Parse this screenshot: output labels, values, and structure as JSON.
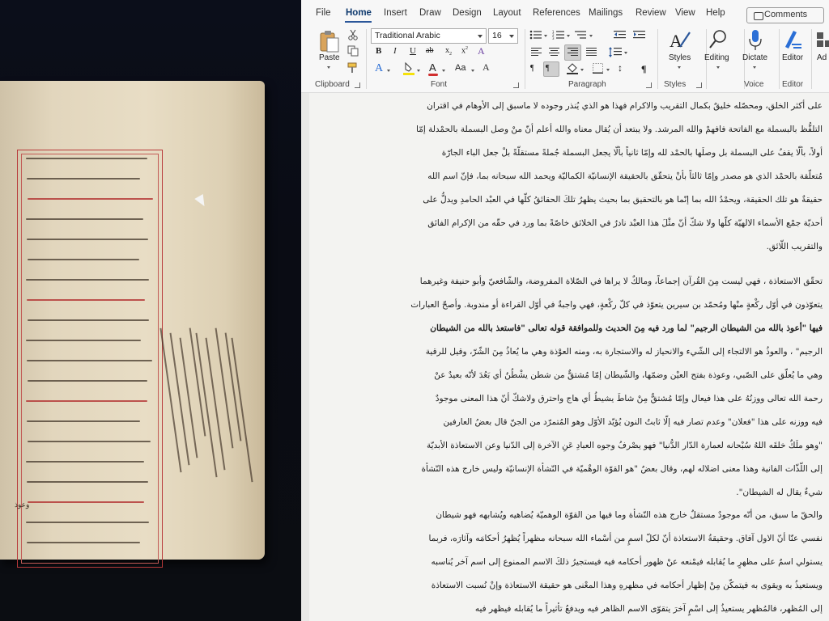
{
  "menu": {
    "file": "File",
    "home": "Home",
    "insert": "Insert",
    "draw": "Draw",
    "design": "Design",
    "layout": "Layout",
    "references": "References",
    "mailings": "Mailings",
    "review": "Review",
    "view": "View",
    "help": "Help",
    "comments": "Comments"
  },
  "ribbon": {
    "clipboard": {
      "paste": "Paste",
      "label": "Clipboard"
    },
    "font": {
      "name": "Traditional Arabic",
      "size": "16",
      "label": "Font"
    },
    "paragraph": {
      "label": "Paragraph"
    },
    "styles": {
      "button": "Styles",
      "label": "Styles"
    },
    "editing": {
      "button": "Editing"
    },
    "voice": {
      "button": "Dictate",
      "label": "Voice"
    },
    "editor": {
      "button": "Editor",
      "label": "Editor"
    },
    "addins": {
      "button": "Ad"
    }
  },
  "icons": [
    "paste-icon",
    "cut-icon",
    "copy-icon",
    "format-painter-icon",
    "bold-icon",
    "italic-icon",
    "underline-icon",
    "strikethrough-icon",
    "subscript-icon",
    "superscript-icon",
    "text-effects-icon",
    "highlight-icon",
    "font-color-icon",
    "change-case-icon",
    "bullets-icon",
    "numbering-icon",
    "multilevel-icon",
    "decrease-indent-icon",
    "increase-indent-icon",
    "align-left-icon",
    "center-icon",
    "align-right-icon",
    "justify-icon",
    "line-spacing-icon",
    "ltr-icon",
    "rtl-icon",
    "shading-icon",
    "borders-icon",
    "pilcrow-icon",
    "styles-icon",
    "search-icon",
    "microphone-icon",
    "editor-icon"
  ],
  "colors": {
    "accent": "#2b579a",
    "highlight": "#f5e10a",
    "font_color": "#d12f2f",
    "ink_red": "#b2302f"
  },
  "manuscript": {
    "footer": "وعوذ"
  },
  "document": {
    "paragraphs": [
      [
        "على أكثر الخلق، ومحصّله خليقٌ بكمال التقريب والاكرام فهذا هو الذي يُنذر وجوده لا ماسبق إلى الأوهام في اقتران",
        "التلفُّظ بالبسملة مع الفاتحة فافهمْ والله المرشد. ولا يبتعد أن يُقال معناه والله أعلم أنّ منْ وصل البسملة بالحمْدلة إمّا",
        "أولاً، بألّا يقفُ على البسملة بل وصلَها بالحمْد لله وإمّا ثانياً بألّا يجعل البسملة جُملةً مستقلّةً بلْ جعل الباء الجارّة",
        "مُتعلّقة بالحمْد الذي هو مصدر وإمّا ثالثاً بأنْ يتحقّق بالحقيقة الإنسانيّة الكماليّة ويحمد الله سبحانه بما، فإنّ اسم الله",
        "حقيقةٌ هو تلك الحقيقة، ويحمْدُ الله بما إنّما هو بالتحقيق بما بحيث يظهرُ تلكَ الحقائقُ كلّها في العبْد الحامدِ ويدلُّ على",
        "أحديّة جمْع الأسماء الالهيّة كلّها ولا شكّ أنّ مثْلَ هذا العبْد نادرٌ في الخلائق خاصّةً بما ورد في حقّه من الإكرام الفائق",
        "والتقريب اللّائق."
      ],
      [
        "تحقّق الاستعاذة ، فهي ليست مِنَ القُرآن إجماعاً، ومالكٌ لا يراها في الصّلاة المفروضة، والشّافعيّ وأبو حنيفة وغيرهما",
        "يتعوّذون في أوّل ركْعةٍ منْها ومُحمّد بن سيرين يتعوّذ في كلّ ركْعةٍ، فهي واجبةٌ في أوّل القراءة أو مندوبة. وأصحّ العبارات",
        "فيها \"أعوذ بالله من الشيطان الرجيم\" لما ورد فيه مِنَ الحديث وللموافقة قوله تعالى \"فاستعذ بالله من الشيطان",
        "الرجيم\" ، والعوذُ هو الالتجاء إلى الشّيء والانحياز له والاستجارة به، ومنه العوْذة وهي ما يُعاذُ مِنَ الشّرّ، وقيل للرقية",
        "وهي ما يُعلّق على الصّبي، وعوذة بفتح العيْن وضمّها، والشّيطان إمّا مُشتقٌّ من شطن يشْطُنُ أي بَعُدَ لأنّه بعيدٌ عنْ",
        "رحمة الله تعالى ووزنُهُ على هذا فيعال وإمّا مُشتقٌّ مِنْ شاطَ يشيطُ أي هاج واحترق ولاشكّ أنّ هذا المعنى موجودٌ",
        "فيه ووزنه على هذا \"فعلان\" وعدم تصار فيه إلّا ثابتُ النون يُؤيّد الأوّل وهو المُتمرّد من الجنّ قال بعضُ العارفين",
        "\"وهو ملَكٌ خلقَه اللهُ سُبْحانه لعمارة الدّار الدُّنيا\" فهو يصْرفُ وجوه العبادِ عَنِ الآخرة إلى الدّنيا وعن الاستعاذة الأبديّة",
        "إلى اللّذّات الفانية وهذا معنى اضلاله لهم، وقال بعضٌ \"هو القوّة الوهْميّة في النّشأة الإنسانيّة وليس خارج هذه النّشأة",
        "شيءٌ يقال له الشيطان\"."
      ],
      [
        "والحقّ ما سبق، من أنّه موجودٌ مستقلٌ خارج هذه النّشأة وما فيها من القوّة الوهميّة يُضاهيه ويُشابهه فهو شيطان",
        "نفسي عنّا أنّ الاول آفاق. وحقيقةُ الاستعاذة أنّ لكلّ اسمٍ من أسْماء الله سبحانه مظهراً يُظهرُ أحكامَه وآثارَه، فربما",
        "يستولي اسمٌ على مظهرٍ ما يُقابله فيمْنعه عنْ ظهور أحكامه فيه فيستجيرُ ذلكَ الاسم الممنوع إلى اسم آخر يُناسبه",
        "ويستعيذُ به ويقوى به فيتمكّن مِنْ إظهار أحكامه في مظهرهِ وهذا المعْنى هو حقيقة الاستعاذة وإنْ نُسبت الاستعاذة",
        "إلى المُظهر، فالمُظهر يستعيذُ إلى اسْمٍ آخرَ يتقوّى الاسم الظاهر فيه ويدفعُ تأثيراً ما يُقابله فيظهر فيه"
      ]
    ]
  }
}
